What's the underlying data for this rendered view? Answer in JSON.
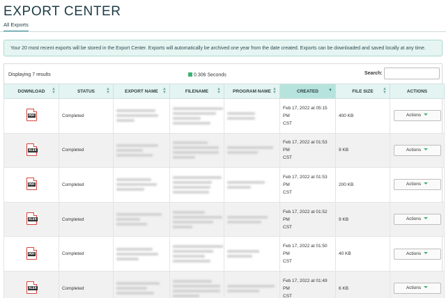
{
  "header": {
    "title": "EXPORT CENTER",
    "tab_label": "All Exports"
  },
  "notice": "Your 20 most recent exports will be stored in the Export Center. Exports will automatically be archived one year from the date created. Exports can be downloaded and saved locally at any time.",
  "table_info": {
    "results_text": "Displaying 7 results",
    "timing_text": "0.306 Seconds",
    "timing_color": "#3cb371",
    "search_label": "Search:",
    "search_value": "",
    "search_placeholder": ""
  },
  "columns": {
    "download": "DOWNLOAD",
    "status": "STATUS",
    "export_name": "EXPORT NAME",
    "filename": "FILENAME",
    "program_name": "PROGRAM NAME",
    "created": "CREATED",
    "file_size": "FILE SIZE",
    "actions": "ACTIONS"
  },
  "sort": {
    "active_column": "CREATED",
    "direction": "descending"
  },
  "colors": {
    "accent": "#2a8d93",
    "header_bg": "#e4f4f2",
    "active_header_bg": "#b6e4dd",
    "file_icon": "#d8413a",
    "caret": "#3cb371"
  },
  "rows": [
    {
      "file_type": "PDF",
      "icon": "pdf-file-icon",
      "status": "Completed",
      "created_line1": "Feb 17, 2022 at 05:15 PM",
      "created_line2": "CST",
      "size": "400 KB",
      "action_label": "Actions"
    },
    {
      "file_type": "XLSX",
      "icon": "xlsx-file-icon",
      "status": "Completed",
      "created_line1": "Feb 17, 2022 at 01:53 PM",
      "created_line2": "CST",
      "size": "9 KB",
      "action_label": "Actions"
    },
    {
      "file_type": "PDF",
      "icon": "pdf-file-icon",
      "status": "Completed",
      "created_line1": "Feb 17, 2022 at 01:53 PM",
      "created_line2": "CST",
      "size": "200 KB",
      "action_label": "Actions"
    },
    {
      "file_type": "XLSX",
      "icon": "xlsx-file-icon",
      "status": "Completed",
      "created_line1": "Feb 17, 2022 at 01:52 PM",
      "created_line2": "CST",
      "size": "9 KB",
      "action_label": "Actions"
    },
    {
      "file_type": "PDF",
      "icon": "pdf-file-icon",
      "status": "Completed",
      "created_line1": "Feb 17, 2022 at 01:50 PM",
      "created_line2": "CST",
      "size": "40 KB",
      "action_label": "Actions"
    },
    {
      "file_type": "XLSX",
      "icon": "xlsx-file-icon",
      "status": "Completed",
      "created_line1": "Feb 17, 2022 at 01:49 PM",
      "created_line2": "CST",
      "size": "6 KB",
      "action_label": "Actions"
    }
  ]
}
